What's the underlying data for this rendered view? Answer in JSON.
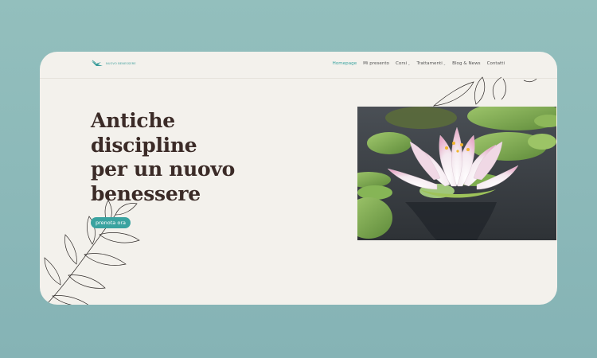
{
  "logo": {
    "text": "NUOVO BENESSERE",
    "icon": "bird-logo-icon"
  },
  "nav": {
    "items": [
      {
        "label": "Homepage",
        "active": true,
        "dropdown": false
      },
      {
        "label": "Mi presento",
        "active": false,
        "dropdown": false
      },
      {
        "label": "Corsi",
        "active": false,
        "dropdown": true
      },
      {
        "label": "Trattamenti",
        "active": false,
        "dropdown": true
      },
      {
        "label": "Blog & News",
        "active": false,
        "dropdown": false
      },
      {
        "label": "Contatti",
        "active": false,
        "dropdown": false
      }
    ]
  },
  "hero": {
    "title_lines": [
      "Antiche",
      "discipline",
      "per un nuovo",
      "benessere"
    ],
    "cta_label": "prenota ora"
  },
  "colors": {
    "background": "#8fbcbb",
    "card": "#f3f1ec",
    "accent": "#3aa3a0",
    "title": "#3b2b27"
  }
}
